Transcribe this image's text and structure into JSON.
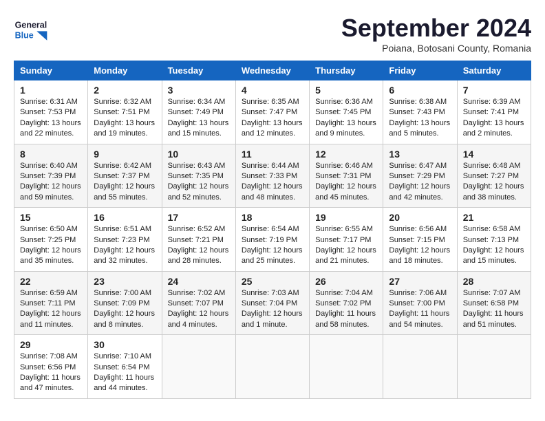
{
  "header": {
    "logo_line1": "General",
    "logo_line2": "Blue",
    "month": "September 2024",
    "location": "Poiana, Botosani County, Romania"
  },
  "days_of_week": [
    "Sunday",
    "Monday",
    "Tuesday",
    "Wednesday",
    "Thursday",
    "Friday",
    "Saturday"
  ],
  "weeks": [
    [
      {
        "day": "1",
        "info": "Sunrise: 6:31 AM\nSunset: 7:53 PM\nDaylight: 13 hours\nand 22 minutes."
      },
      {
        "day": "2",
        "info": "Sunrise: 6:32 AM\nSunset: 7:51 PM\nDaylight: 13 hours\nand 19 minutes."
      },
      {
        "day": "3",
        "info": "Sunrise: 6:34 AM\nSunset: 7:49 PM\nDaylight: 13 hours\nand 15 minutes."
      },
      {
        "day": "4",
        "info": "Sunrise: 6:35 AM\nSunset: 7:47 PM\nDaylight: 13 hours\nand 12 minutes."
      },
      {
        "day": "5",
        "info": "Sunrise: 6:36 AM\nSunset: 7:45 PM\nDaylight: 13 hours\nand 9 minutes."
      },
      {
        "day": "6",
        "info": "Sunrise: 6:38 AM\nSunset: 7:43 PM\nDaylight: 13 hours\nand 5 minutes."
      },
      {
        "day": "7",
        "info": "Sunrise: 6:39 AM\nSunset: 7:41 PM\nDaylight: 13 hours\nand 2 minutes."
      }
    ],
    [
      {
        "day": "8",
        "info": "Sunrise: 6:40 AM\nSunset: 7:39 PM\nDaylight: 12 hours\nand 59 minutes."
      },
      {
        "day": "9",
        "info": "Sunrise: 6:42 AM\nSunset: 7:37 PM\nDaylight: 12 hours\nand 55 minutes."
      },
      {
        "day": "10",
        "info": "Sunrise: 6:43 AM\nSunset: 7:35 PM\nDaylight: 12 hours\nand 52 minutes."
      },
      {
        "day": "11",
        "info": "Sunrise: 6:44 AM\nSunset: 7:33 PM\nDaylight: 12 hours\nand 48 minutes."
      },
      {
        "day": "12",
        "info": "Sunrise: 6:46 AM\nSunset: 7:31 PM\nDaylight: 12 hours\nand 45 minutes."
      },
      {
        "day": "13",
        "info": "Sunrise: 6:47 AM\nSunset: 7:29 PM\nDaylight: 12 hours\nand 42 minutes."
      },
      {
        "day": "14",
        "info": "Sunrise: 6:48 AM\nSunset: 7:27 PM\nDaylight: 12 hours\nand 38 minutes."
      }
    ],
    [
      {
        "day": "15",
        "info": "Sunrise: 6:50 AM\nSunset: 7:25 PM\nDaylight: 12 hours\nand 35 minutes."
      },
      {
        "day": "16",
        "info": "Sunrise: 6:51 AM\nSunset: 7:23 PM\nDaylight: 12 hours\nand 32 minutes."
      },
      {
        "day": "17",
        "info": "Sunrise: 6:52 AM\nSunset: 7:21 PM\nDaylight: 12 hours\nand 28 minutes."
      },
      {
        "day": "18",
        "info": "Sunrise: 6:54 AM\nSunset: 7:19 PM\nDaylight: 12 hours\nand 25 minutes."
      },
      {
        "day": "19",
        "info": "Sunrise: 6:55 AM\nSunset: 7:17 PM\nDaylight: 12 hours\nand 21 minutes."
      },
      {
        "day": "20",
        "info": "Sunrise: 6:56 AM\nSunset: 7:15 PM\nDaylight: 12 hours\nand 18 minutes."
      },
      {
        "day": "21",
        "info": "Sunrise: 6:58 AM\nSunset: 7:13 PM\nDaylight: 12 hours\nand 15 minutes."
      }
    ],
    [
      {
        "day": "22",
        "info": "Sunrise: 6:59 AM\nSunset: 7:11 PM\nDaylight: 12 hours\nand 11 minutes."
      },
      {
        "day": "23",
        "info": "Sunrise: 7:00 AM\nSunset: 7:09 PM\nDaylight: 12 hours\nand 8 minutes."
      },
      {
        "day": "24",
        "info": "Sunrise: 7:02 AM\nSunset: 7:07 PM\nDaylight: 12 hours\nand 4 minutes."
      },
      {
        "day": "25",
        "info": "Sunrise: 7:03 AM\nSunset: 7:04 PM\nDaylight: 12 hours\nand 1 minute."
      },
      {
        "day": "26",
        "info": "Sunrise: 7:04 AM\nSunset: 7:02 PM\nDaylight: 11 hours\nand 58 minutes."
      },
      {
        "day": "27",
        "info": "Sunrise: 7:06 AM\nSunset: 7:00 PM\nDaylight: 11 hours\nand 54 minutes."
      },
      {
        "day": "28",
        "info": "Sunrise: 7:07 AM\nSunset: 6:58 PM\nDaylight: 11 hours\nand 51 minutes."
      }
    ],
    [
      {
        "day": "29",
        "info": "Sunrise: 7:08 AM\nSunset: 6:56 PM\nDaylight: 11 hours\nand 47 minutes."
      },
      {
        "day": "30",
        "info": "Sunrise: 7:10 AM\nSunset: 6:54 PM\nDaylight: 11 hours\nand 44 minutes."
      },
      {
        "day": "",
        "info": ""
      },
      {
        "day": "",
        "info": ""
      },
      {
        "day": "",
        "info": ""
      },
      {
        "day": "",
        "info": ""
      },
      {
        "day": "",
        "info": ""
      }
    ]
  ]
}
